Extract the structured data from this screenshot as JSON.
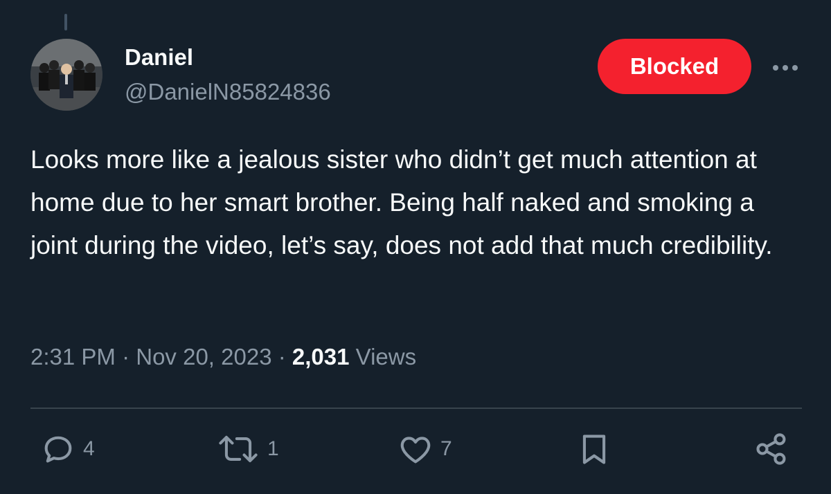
{
  "author": {
    "display_name": "Daniel",
    "handle": "@DanielN85824836",
    "avatar_icon": "avatar-photo"
  },
  "header": {
    "blocked_label": "Blocked",
    "blocked_color": "#f4212e",
    "more_icon": "more-dots-icon"
  },
  "tweet": {
    "text": "Looks more like a jealous sister who didn’t get much attention at home due to her smart brother. Being half naked and smoking a joint during the video, let’s say, does not add that much credibility.",
    "time": "2:31 PM",
    "date": "Nov 20, 2023",
    "separator": "·",
    "views_count": "2,031",
    "views_label": "Views"
  },
  "actions": {
    "reply": {
      "icon": "reply-icon",
      "count": "4"
    },
    "retweet": {
      "icon": "retweet-icon",
      "count": "1"
    },
    "like": {
      "icon": "heart-icon",
      "count": "7"
    },
    "bookmark": {
      "icon": "bookmark-icon"
    },
    "share": {
      "icon": "share-icon"
    }
  },
  "theme": {
    "background": "#15202b",
    "text": "#f7f9f9",
    "secondary_text": "#8b98a5",
    "divider": "#38444d"
  }
}
